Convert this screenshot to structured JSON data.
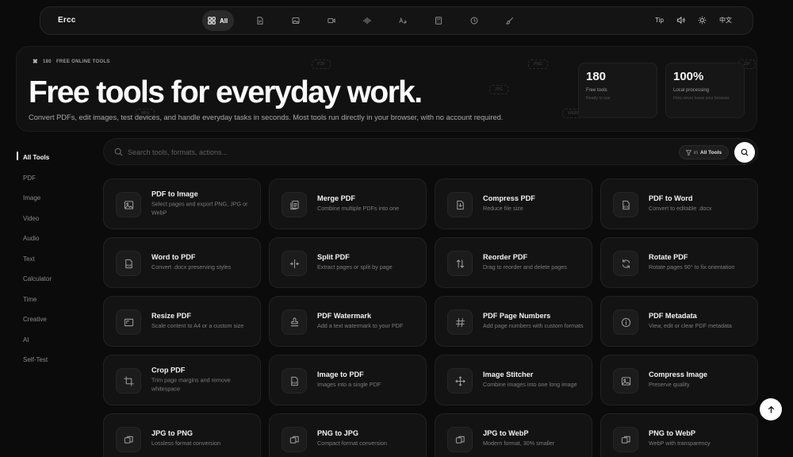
{
  "brand": "Ercc",
  "nav": {
    "all_label": "All",
    "icons": [
      "pdf-icon",
      "image-icon",
      "video-icon",
      "audio-icon",
      "text-icon",
      "calculator-icon",
      "time-icon",
      "creative-icon"
    ],
    "tip": "Tip",
    "lang": "中文"
  },
  "hero": {
    "kicker_count": "180",
    "kicker_text": "FREE ONLINE TOOLS",
    "title": "Free tools for everyday work.",
    "subtitle": "Convert PDFs, edit images, test devices, and handle everyday tasks in seconds. Most tools run directly in your browser, with no account required.",
    "ghost_tags": [
      "PDF",
      "PNG",
      "JPG",
      "WEBP",
      "ZIP",
      "MP4"
    ],
    "stats": [
      {
        "num": "180",
        "label": "Free tools",
        "note": "Ready to use"
      },
      {
        "num": "100%",
        "label": "Local processing",
        "note": "Files never leave your browser"
      }
    ]
  },
  "sidebar": {
    "items": [
      {
        "label": "All Tools"
      },
      {
        "label": "PDF"
      },
      {
        "label": "Image"
      },
      {
        "label": "Video"
      },
      {
        "label": "Audio"
      },
      {
        "label": "Text"
      },
      {
        "label": "Calculator"
      },
      {
        "label": "Time"
      },
      {
        "label": "Creative"
      },
      {
        "label": "AI"
      },
      {
        "label": "Self-Test"
      }
    ]
  },
  "search": {
    "placeholder": "Search tools, formats, actions...",
    "filter_prefix": "in",
    "filter_value": "All Tools"
  },
  "tools": [
    {
      "name": "PDF to Image",
      "desc": "Select pages and export PNG, JPG or WebP",
      "icon": "image-icon"
    },
    {
      "name": "Merge PDF",
      "desc": "Combine multiple PDFs into one",
      "icon": "merge-icon"
    },
    {
      "name": "Compress PDF",
      "desc": "Reduce file size",
      "icon": "compress-icon"
    },
    {
      "name": "PDF to Word",
      "desc": "Convert to editable .docx",
      "icon": "doc-icon"
    },
    {
      "name": "Word to PDF",
      "desc": "Convert .docx preserving styles",
      "icon": "pdf-file-icon"
    },
    {
      "name": "Split PDF",
      "desc": "Extract pages or split by page",
      "icon": "split-icon"
    },
    {
      "name": "Reorder PDF",
      "desc": "Drag to reorder and delete pages",
      "icon": "reorder-icon"
    },
    {
      "name": "Rotate PDF",
      "desc": "Rotate pages 90° to fix orientation",
      "icon": "rotate-icon"
    },
    {
      "name": "Resize PDF",
      "desc": "Scale content to A4 or a custom size",
      "icon": "resize-icon"
    },
    {
      "name": "PDF Watermark",
      "desc": "Add a text watermark to your PDF",
      "icon": "stamp-icon"
    },
    {
      "name": "PDF Page Numbers",
      "desc": "Add page numbers with custom formats",
      "icon": "hash-icon"
    },
    {
      "name": "PDF Metadata",
      "desc": "View, edit or clear PDF metadata",
      "icon": "info-icon"
    },
    {
      "name": "Crop PDF",
      "desc": "Trim page margins and remove whitespace",
      "icon": "crop-icon"
    },
    {
      "name": "Image to PDF",
      "desc": "Images into a single PDF",
      "icon": "pdf-file-icon"
    },
    {
      "name": "Image Stitcher",
      "desc": "Combine images into one long image",
      "icon": "move-icon"
    },
    {
      "name": "Compress Image",
      "desc": "Preserve quality",
      "icon": "image-icon"
    },
    {
      "name": "JPG to PNG",
      "desc": "Lossless format conversion",
      "icon": "convert-icon"
    },
    {
      "name": "PNG to JPG",
      "desc": "Compact format conversion",
      "icon": "convert-icon"
    },
    {
      "name": "JPG to WebP",
      "desc": "Modern format, 30% smaller",
      "icon": "convert-icon"
    },
    {
      "name": "PNG to WebP",
      "desc": "WebP with transparency",
      "icon": "convert-icon"
    }
  ]
}
